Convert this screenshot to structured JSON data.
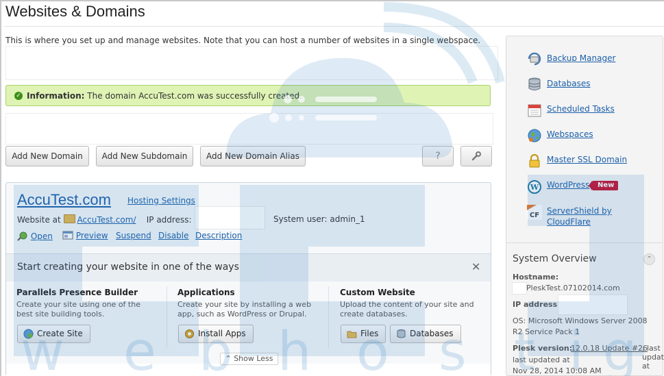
{
  "page": {
    "title": "Websites & Domains",
    "intro": "This is where you set up and manage websites. Note that you can host a number of websites in a single webspace."
  },
  "info": {
    "label": "Information:",
    "message": "The domain AccuTest.com was successfully created."
  },
  "toolbar": {
    "add_domain": "Add New Domain",
    "add_subdomain": "Add New Subdomain",
    "add_alias": "Add New Domain Alias",
    "help_label": "?",
    "settings_icon": "wrench-icon"
  },
  "domain": {
    "name": "AccuTest.com",
    "hosting_settings": "Hosting Settings",
    "website_at_label": "Website at",
    "website_link": "AccuTest.com/",
    "ip_label": "IP address:",
    "system_user": "System user: admin_1",
    "actions": {
      "open": "Open",
      "preview": "Preview",
      "suspend": "Suspend",
      "disable": "Disable",
      "description": "Description"
    }
  },
  "start": {
    "title": "Start creating your website in one of the ways",
    "close": "✕",
    "columns": [
      {
        "title": "Parallels Presence Builder",
        "desc": "Create your site using one of the best site building tools.",
        "buttons": [
          "Create Site"
        ]
      },
      {
        "title": "Applications",
        "desc": "Create your site by installing a web app, such as WordPress or Drupal.",
        "buttons": [
          "Install Apps"
        ]
      },
      {
        "title": "Custom Website",
        "desc": "Upload the content of your site and create databases.",
        "buttons": [
          "Files",
          "Databases"
        ]
      }
    ],
    "show_less": "Show Less"
  },
  "sidebar": {
    "items": [
      {
        "label": "Backup Manager",
        "icon": "backup-icon"
      },
      {
        "label": "Databases",
        "icon": "database-icon"
      },
      {
        "label": "Scheduled Tasks",
        "icon": "calendar-icon"
      },
      {
        "label": "Webspaces",
        "icon": "globe-icon"
      },
      {
        "label": "Master SSL Domain",
        "icon": "lock-icon"
      },
      {
        "label": "WordPress",
        "icon": "wordpress-icon",
        "badge": "New"
      },
      {
        "label_line1": "ServerShield by",
        "label_line2": "CloudFlare",
        "icon": "cloudflare-icon"
      }
    ]
  },
  "overview": {
    "title": "System Overview",
    "collapse": "⌃",
    "hostname_label": "Hostname:",
    "hostname_value": "PleskTest.07102014.com",
    "ip_label": "IP address:",
    "os_line1": "OS: Microsoft Windows Server 2008",
    "os_line2": "R2 Service Pack 1",
    "plesk_label": "Plesk version:",
    "plesk_value": "12.0.18 Update #26",
    "updated_line1": ", last updated at",
    "updated_line2": "Nov 28, 2014 10:08 AM"
  },
  "watermark": {
    "text": "webhosting",
    "colors": {
      "primary": "#2f7fc1",
      "opacity": "0.18"
    }
  },
  "colors": {
    "link": "#1b5fa8",
    "info_bg": "#dff3b4",
    "info_border": "#a9d26a",
    "new_badge": "#c8102e"
  }
}
